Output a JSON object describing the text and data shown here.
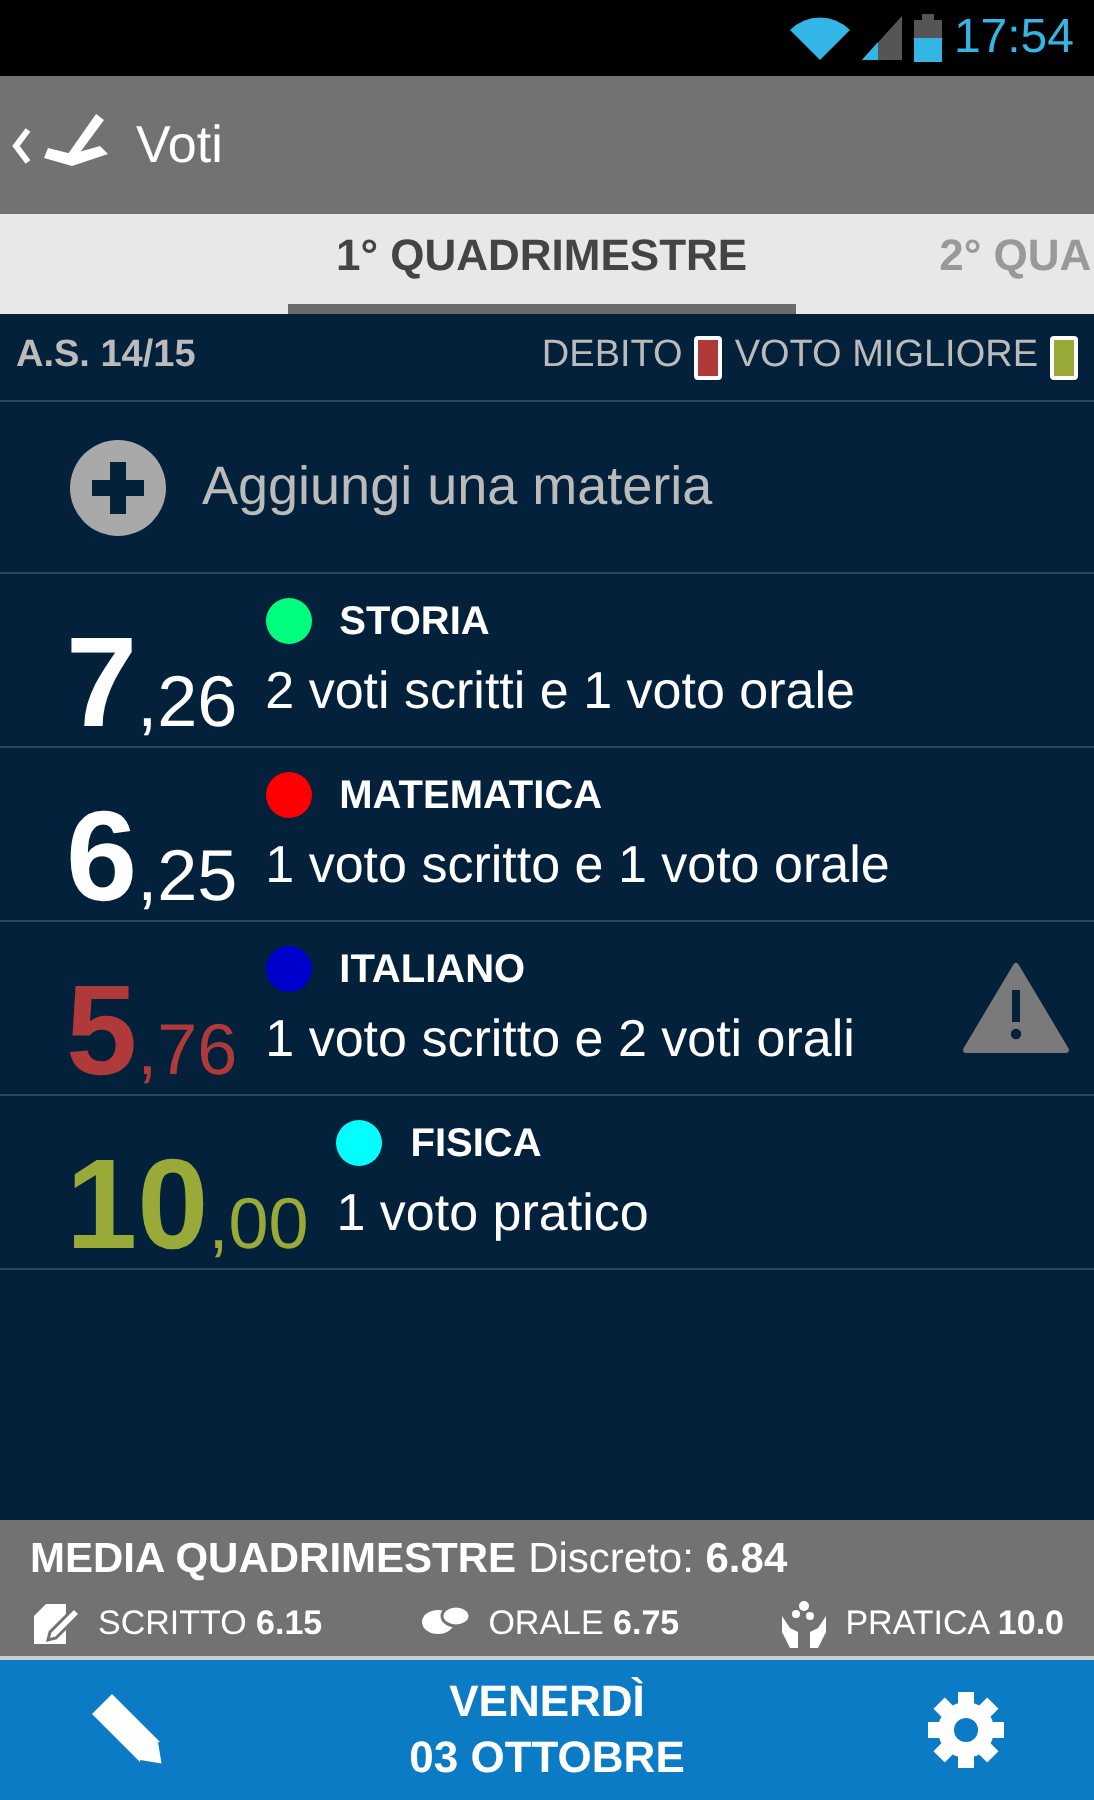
{
  "status_bar": {
    "time": "17:54"
  },
  "app_bar": {
    "title": "Voti"
  },
  "tabs": [
    {
      "label": "1° QUADRIMESTRE",
      "selected": true
    },
    {
      "label": "2° QUA",
      "selected": false
    }
  ],
  "legend": {
    "school_year": "A.S. 14/15",
    "items": [
      {
        "label": "DEBITO",
        "color": "#b03a3a"
      },
      {
        "label": "VOTO MIGLIORE",
        "color": "#9aaa38"
      }
    ]
  },
  "add_subject": {
    "label": "Aggiungi una materia"
  },
  "subjects": [
    {
      "name": "STORIA",
      "color": "#00ff7f",
      "grade_int": "7",
      "grade_dec": ",26",
      "debt": false,
      "best": false,
      "summary": "2 voti scritti e 1 voto orale",
      "warning": false
    },
    {
      "name": "MATEMATICA",
      "color": "#ff0000",
      "grade_int": "6",
      "grade_dec": ",25",
      "debt": false,
      "best": false,
      "summary": "1 voto scritto e 1 voto orale",
      "warning": false
    },
    {
      "name": "ITALIANO",
      "color": "#0000cc",
      "grade_int": "5",
      "grade_dec": ",76",
      "debt": true,
      "best": false,
      "summary": "1 voto scritto e 2 voti orali",
      "warning": true
    },
    {
      "name": "FISICA",
      "color": "#00ffff",
      "grade_int": "10",
      "grade_dec": ",00",
      "debt": false,
      "best": true,
      "summary": "1 voto pratico",
      "warning": false
    }
  ],
  "summary": {
    "title": "MEDIA QUADRIMESTRE",
    "rating": "Discreto: **6.84**",
    "stats": [
      {
        "kind": "written",
        "text": "SCRITTO **6.15**"
      },
      {
        "kind": "oral",
        "text": "ORALE **6.75**"
      },
      {
        "kind": "practical",
        "text": "PRATICA **10.0**"
      }
    ]
  },
  "bottom_bar": {
    "day": "VENERDÌ",
    "date": "03 OTTOBRE"
  }
}
